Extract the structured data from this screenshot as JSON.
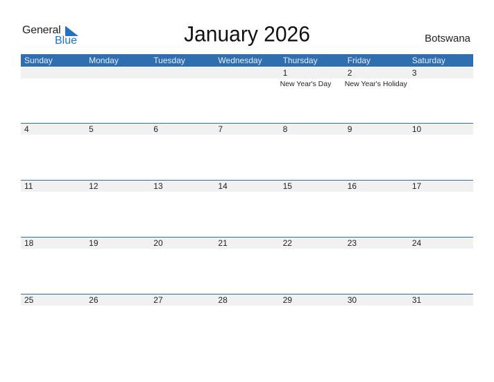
{
  "logo": {
    "word1": "General",
    "word2": "Blue",
    "icon": "triangle-flag-icon"
  },
  "title": "January 2026",
  "country": "Botswana",
  "colors": {
    "accent": "#2f6fb0",
    "logo_blue": "#1f73c2",
    "band": "#f1f1f1"
  },
  "weekdays": [
    "Sunday",
    "Monday",
    "Tuesday",
    "Wednesday",
    "Thursday",
    "Friday",
    "Saturday"
  ],
  "weeks": [
    {
      "days": [
        {
          "num": "",
          "holiday": ""
        },
        {
          "num": "",
          "holiday": ""
        },
        {
          "num": "",
          "holiday": ""
        },
        {
          "num": "",
          "holiday": ""
        },
        {
          "num": "1",
          "holiday": "New Year's Day"
        },
        {
          "num": "2",
          "holiday": "New Year's Holiday"
        },
        {
          "num": "3",
          "holiday": ""
        }
      ]
    },
    {
      "days": [
        {
          "num": "4",
          "holiday": ""
        },
        {
          "num": "5",
          "holiday": ""
        },
        {
          "num": "6",
          "holiday": ""
        },
        {
          "num": "7",
          "holiday": ""
        },
        {
          "num": "8",
          "holiday": ""
        },
        {
          "num": "9",
          "holiday": ""
        },
        {
          "num": "10",
          "holiday": ""
        }
      ]
    },
    {
      "days": [
        {
          "num": "11",
          "holiday": ""
        },
        {
          "num": "12",
          "holiday": ""
        },
        {
          "num": "13",
          "holiday": ""
        },
        {
          "num": "14",
          "holiday": ""
        },
        {
          "num": "15",
          "holiday": ""
        },
        {
          "num": "16",
          "holiday": ""
        },
        {
          "num": "17",
          "holiday": ""
        }
      ]
    },
    {
      "days": [
        {
          "num": "18",
          "holiday": ""
        },
        {
          "num": "19",
          "holiday": ""
        },
        {
          "num": "20",
          "holiday": ""
        },
        {
          "num": "21",
          "holiday": ""
        },
        {
          "num": "22",
          "holiday": ""
        },
        {
          "num": "23",
          "holiday": ""
        },
        {
          "num": "24",
          "holiday": ""
        }
      ]
    },
    {
      "days": [
        {
          "num": "25",
          "holiday": ""
        },
        {
          "num": "26",
          "holiday": ""
        },
        {
          "num": "27",
          "holiday": ""
        },
        {
          "num": "28",
          "holiday": ""
        },
        {
          "num": "29",
          "holiday": ""
        },
        {
          "num": "30",
          "holiday": ""
        },
        {
          "num": "31",
          "holiday": ""
        }
      ]
    }
  ]
}
